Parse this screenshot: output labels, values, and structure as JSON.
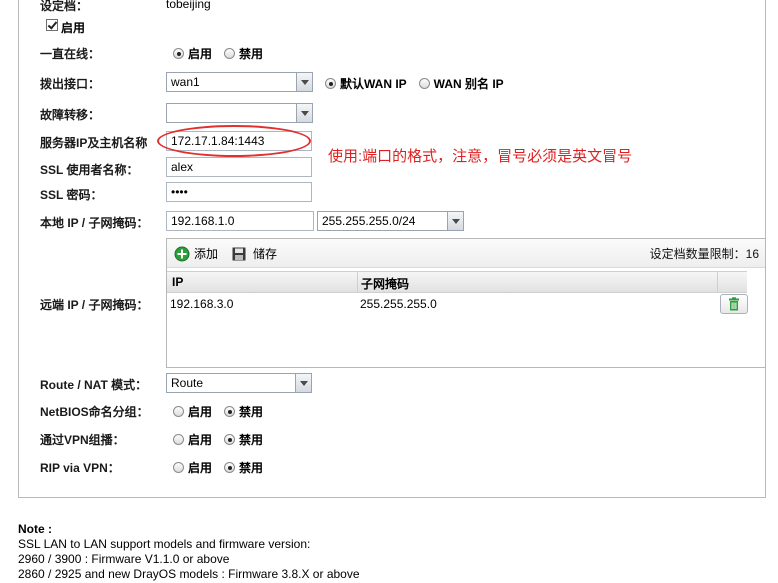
{
  "profile": {
    "label": "设定档：",
    "value": "tobeijing",
    "enable_label": "启用"
  },
  "always_on": {
    "label": "一直在线：",
    "opt_enable": "启用",
    "opt_disable": "禁用"
  },
  "dial_out": {
    "label": "拨出接口：",
    "value": "wan1",
    "opt_default_wan": "默认WAN IP",
    "opt_alias": "WAN 别名 IP"
  },
  "failover": {
    "label": "故障转移：",
    "value": ""
  },
  "server": {
    "label": "服务器IP及主机名称",
    "value": "172.17.1.84:1443"
  },
  "annotation": "使用:端口的格式，注意，冒号必须是英文冒号",
  "ssl_user": {
    "label": "SSL 使用者名称：",
    "value": "alex"
  },
  "ssl_pass": {
    "label": "SSL 密码：",
    "value": "••••"
  },
  "local_ip": {
    "label": "本地 IP / 子网掩码：",
    "ip": "192.168.1.0",
    "mask": "255.255.255.0/24"
  },
  "remote": {
    "label": "远端 IP / 子网掩码：",
    "add_label": "添加",
    "save_label": "储存",
    "count_label": "设定档数量限制：16",
    "col_ip": "IP",
    "col_mask": "子网掩码",
    "rows": [
      {
        "ip": "192.168.3.0",
        "mask": "255.255.255.0"
      }
    ]
  },
  "route_nat": {
    "label": "Route / NAT 模式：",
    "value": "Route"
  },
  "netbios": {
    "label": "NetBIOS命名分组：",
    "opt_enable": "启用",
    "opt_disable": "禁用"
  },
  "multicast": {
    "label": "通过VPN组播：",
    "opt_enable": "启用",
    "opt_disable": "禁用"
  },
  "rip": {
    "label": "RIP via VPN：",
    "opt_enable": "启用",
    "opt_disable": "禁用"
  },
  "note": {
    "title": "Note :",
    "line1": "SSL LAN to LAN support models and firmware version:",
    "line2": "2960 / 3900 : Firmware V1.1.0 or above",
    "line3": "2860 / 2925 and new DrayOS models : Firmware 3.8.X or above"
  },
  "colors": {
    "annotation": "#e02020",
    "trash": "#2e9e3a",
    "add": "#2e9e3a"
  }
}
